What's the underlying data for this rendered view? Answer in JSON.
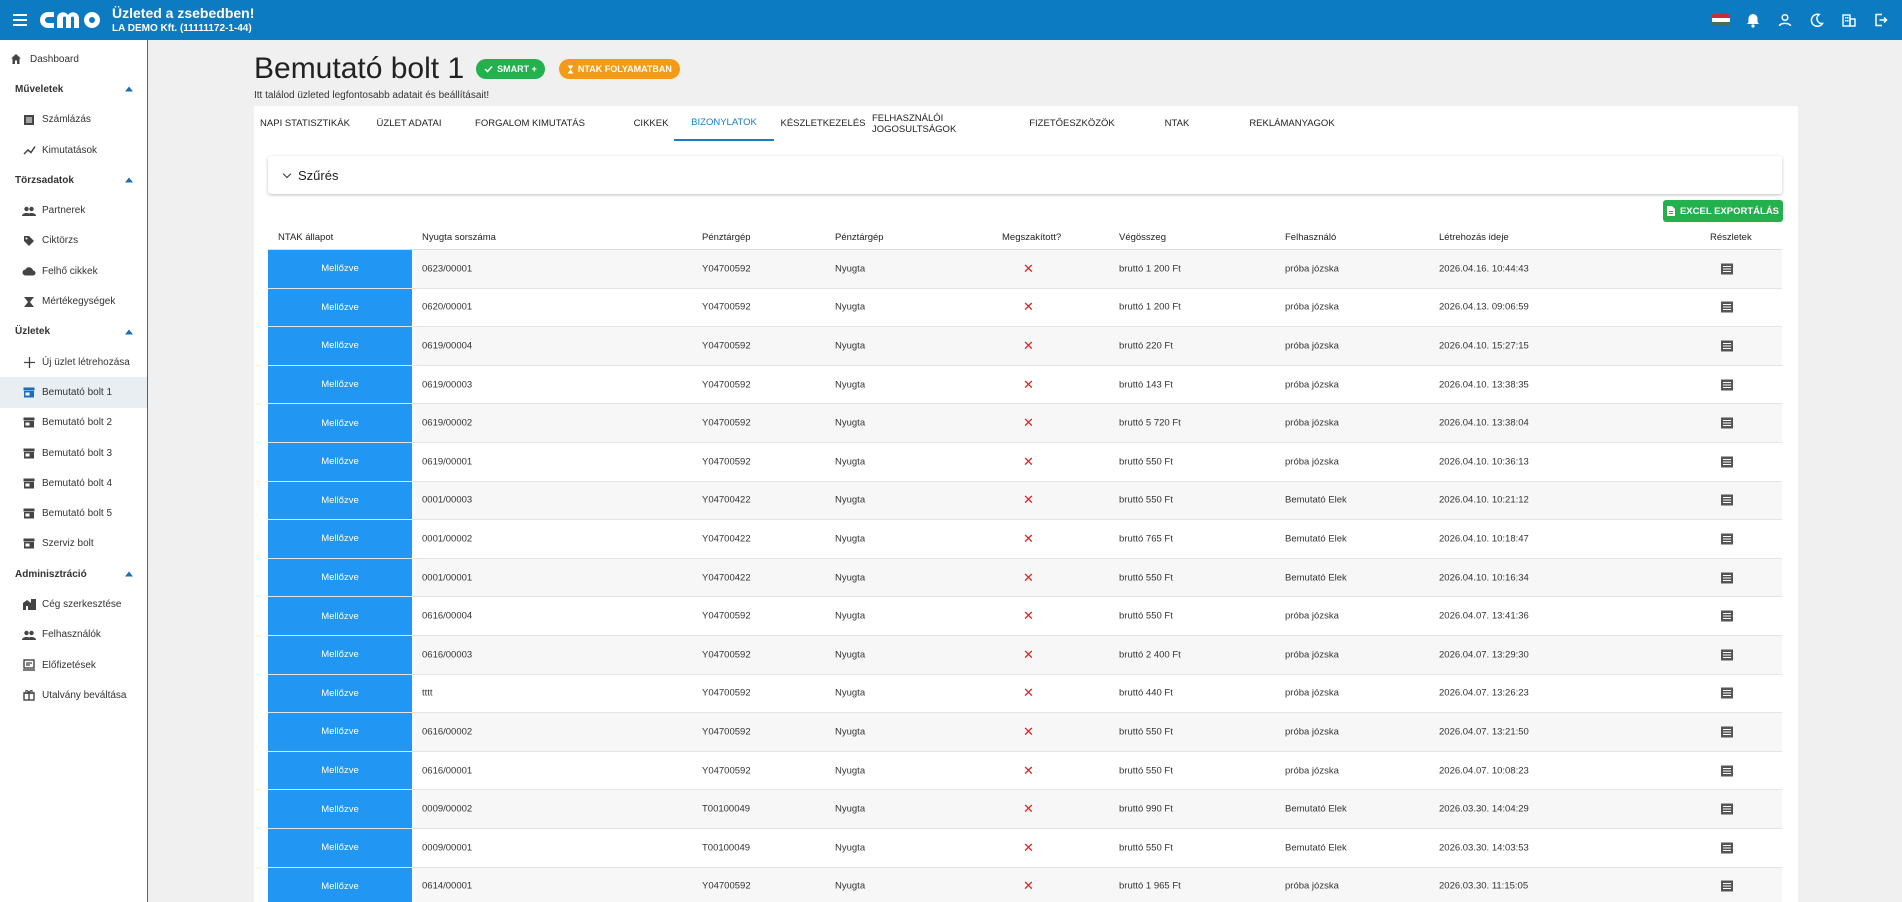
{
  "header": {
    "slogan": "Üzleted a zsebedben!",
    "company": "LA DEMO Kft. (11111172-1-44)",
    "icons": [
      "hungarian-flag-icon",
      "bell-icon",
      "user-icon",
      "moon-icon",
      "building-icon",
      "logout-icon"
    ]
  },
  "sidebar": {
    "dashboard": "Dashboard",
    "sections": {
      "muveletek": "Műveletek",
      "torzsadatok": "Törzsadatok",
      "uzletek": "Üzletek",
      "admin": "Adminisztráció"
    },
    "items": {
      "szamlazas": "Számlázás",
      "kimutatasok": "Kimutatások",
      "partnerek": "Partnerek",
      "ciktorzs": "Ciktörzs",
      "felho": "Felhő cikkek",
      "mertek": "Mértékegységek",
      "uj_uzlet": "Új üzlet létrehozása",
      "bolt1": "Bemutató bolt 1",
      "bolt2": "Bemutató bolt 2",
      "bolt3": "Bemutató bolt 3",
      "bolt4": "Bemutató bolt 4",
      "bolt5": "Bemutató bolt 5",
      "szerviz": "Szerviz bolt",
      "ceg": "Cég szerkesztése",
      "felhasznalok": "Felhasználók",
      "elofizetesek": "Előfizetések",
      "utalvany": "Utalvány beváltása"
    }
  },
  "page": {
    "title": "Bemutató bolt 1",
    "badge_smart": "SMART +",
    "badge_ntak": "NTAK FOLYAMATBAN",
    "subtitle": "Itt találod üzleted legfontosabb adatait és beállításait!"
  },
  "tabs": {
    "napi": "NAPI STATISZTIKÁK",
    "uzlet": "ÜZLET ADATAI",
    "forgalom": "FORGALOM KIMUTATÁS",
    "cikkek": "CIKKEK",
    "bizonylatok": "BIZONYLATOK",
    "keszlet": "KÉSZLETKEZELÉS",
    "jogosultsag": "FELHASZNÁLÓI JOGOSULTSÁGOK",
    "fizeto": "FIZETŐESZKÖZÖK",
    "ntak": "NTAK",
    "reklam": "REKLÁMANYAGOK"
  },
  "filter": {
    "label": "Szűrés"
  },
  "export": {
    "label": "EXCEL EXPORTÁLÁS"
  },
  "table": {
    "headers": {
      "ntak": "NTAK állapot",
      "nyugta": "Nyugta sorszáma",
      "penztargep1": "Pénztárgép",
      "penztargep2": "Pénztárgép",
      "megszakitott": "Megszakított?",
      "vegosszeg": "Végösszeg",
      "felhasznalo": "Felhasználó",
      "letrehozas": "Létrehozás ideje",
      "reszletek": "Részletek"
    },
    "rows": [
      {
        "status": "Mellőzve",
        "nyugta": "0623/00001",
        "penztargep": "Y04700592",
        "tipus": "Nyugta",
        "vegosszeg": "bruttó 1 200 Ft",
        "felhasznalo": "próba józska",
        "datum": "2026.04.16. 10:44:43"
      },
      {
        "status": "Mellőzve",
        "nyugta": "0620/00001",
        "penztargep": "Y04700592",
        "tipus": "Nyugta",
        "vegosszeg": "bruttó 1 200 Ft",
        "felhasznalo": "próba józska",
        "datum": "2026.04.13. 09:06:59"
      },
      {
        "status": "Mellőzve",
        "nyugta": "0619/00004",
        "penztargep": "Y04700592",
        "tipus": "Nyugta",
        "vegosszeg": "bruttó 220 Ft",
        "felhasznalo": "próba józska",
        "datum": "2026.04.10. 15:27:15"
      },
      {
        "status": "Mellőzve",
        "nyugta": "0619/00003",
        "penztargep": "Y04700592",
        "tipus": "Nyugta",
        "vegosszeg": "bruttó 143 Ft",
        "felhasznalo": "próba józska",
        "datum": "2026.04.10. 13:38:35"
      },
      {
        "status": "Mellőzve",
        "nyugta": "0619/00002",
        "penztargep": "Y04700592",
        "tipus": "Nyugta",
        "vegosszeg": "bruttó 5 720 Ft",
        "felhasznalo": "próba józska",
        "datum": "2026.04.10. 13:38:04"
      },
      {
        "status": "Mellőzve",
        "nyugta": "0619/00001",
        "penztargep": "Y04700592",
        "tipus": "Nyugta",
        "vegosszeg": "bruttó 550 Ft",
        "felhasznalo": "próba józska",
        "datum": "2026.04.10. 10:36:13"
      },
      {
        "status": "Mellőzve",
        "nyugta": "0001/00003",
        "penztargep": "Y04700422",
        "tipus": "Nyugta",
        "vegosszeg": "bruttó 550 Ft",
        "felhasznalo": "Bemutató Elek",
        "datum": "2026.04.10. 10:21:12"
      },
      {
        "status": "Mellőzve",
        "nyugta": "0001/00002",
        "penztargep": "Y04700422",
        "tipus": "Nyugta",
        "vegosszeg": "bruttó 765 Ft",
        "felhasznalo": "Bemutató Elek",
        "datum": "2026.04.10. 10:18:47"
      },
      {
        "status": "Mellőzve",
        "nyugta": "0001/00001",
        "penztargep": "Y04700422",
        "tipus": "Nyugta",
        "vegosszeg": "bruttó 550 Ft",
        "felhasznalo": "Bemutató Elek",
        "datum": "2026.04.10. 10:16:34"
      },
      {
        "status": "Mellőzve",
        "nyugta": "0616/00004",
        "penztargep": "Y04700592",
        "tipus": "Nyugta",
        "vegosszeg": "bruttó 550 Ft",
        "felhasznalo": "próba józska",
        "datum": "2026.04.07. 13:41:36"
      },
      {
        "status": "Mellőzve",
        "nyugta": "0616/00003",
        "penztargep": "Y04700592",
        "tipus": "Nyugta",
        "vegosszeg": "bruttó 2 400 Ft",
        "felhasznalo": "próba józska",
        "datum": "2026.04.07. 13:29:30"
      },
      {
        "status": "Mellőzve",
        "nyugta": "tttt",
        "penztargep": "Y04700592",
        "tipus": "Nyugta",
        "vegosszeg": "bruttó 440 Ft",
        "felhasznalo": "próba józska",
        "datum": "2026.04.07. 13:26:23"
      },
      {
        "status": "Mellőzve",
        "nyugta": "0616/00002",
        "penztargep": "Y04700592",
        "tipus": "Nyugta",
        "vegosszeg": "bruttó 550 Ft",
        "felhasznalo": "próba józska",
        "datum": "2026.04.07. 13:21:50"
      },
      {
        "status": "Mellőzve",
        "nyugta": "0616/00001",
        "penztargep": "Y04700592",
        "tipus": "Nyugta",
        "vegosszeg": "bruttó 550 Ft",
        "felhasznalo": "próba józska",
        "datum": "2026.04.07. 10:08:23"
      },
      {
        "status": "Mellőzve",
        "nyugta": "0009/00002",
        "penztargep": "T00100049",
        "tipus": "Nyugta",
        "vegosszeg": "bruttó 990 Ft",
        "felhasznalo": "Bemutató Elek",
        "datum": "2026.03.30. 14:04:29"
      },
      {
        "status": "Mellőzve",
        "nyugta": "0009/00001",
        "penztargep": "T00100049",
        "tipus": "Nyugta",
        "vegosszeg": "bruttó 550 Ft",
        "felhasznalo": "Bemutató Elek",
        "datum": "2026.03.30. 14:03:53"
      },
      {
        "status": "Mellőzve",
        "nyugta": "0614/00001",
        "penztargep": "Y04700592",
        "tipus": "Nyugta",
        "vegosszeg": "bruttó 1 965 Ft",
        "felhasznalo": "próba józska",
        "datum": "2026.03.30. 11:15:05"
      }
    ]
  },
  "colors": {
    "topbar": "#0d7bc2",
    "status_blue": "#2196f3",
    "green": "#22b14c",
    "orange": "#f59a14",
    "red_x": "#e02020"
  }
}
